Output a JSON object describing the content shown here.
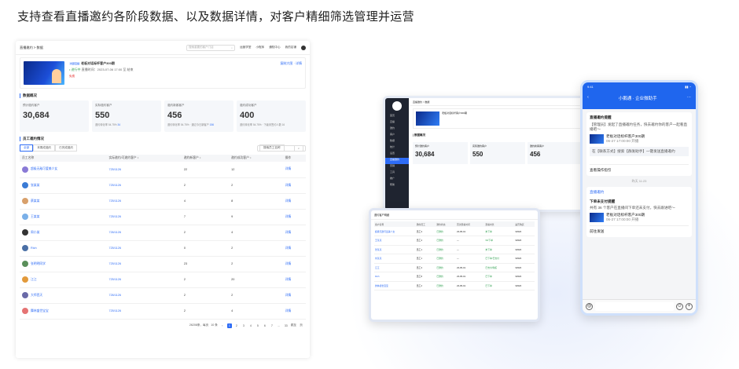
{
  "heading": "支持查看直播邀约各阶段数据、以及数据详情，对客户精细筛选管理并运营",
  "main": {
    "breadcrumb": "直播邀约 > 数据",
    "search_placeholder": "搜索重要的客户门店",
    "toolbar": [
      "运营学堂",
      "小程序",
      "通知中心",
      "我的店铺"
    ],
    "live": {
      "badge": "内部直播",
      "title": "老板对话标杆客户300期",
      "status": "• 进行中",
      "time": "直播时间：2023-07-06 17:00 至 结束",
      "tag": "免费",
      "action": "复制大图 · 详情"
    },
    "overview_title": "数据概况",
    "stats": [
      {
        "label": "预计邀约客户",
        "value": "30,684",
        "sub": ""
      },
      {
        "label": "实际邀约客户",
        "value": "550",
        "sub": "邀约转化率 54.75%",
        "sub2": "34"
      },
      {
        "label": "邀约新客客户",
        "value": "456",
        "sub": "邀约转化率 54.75%  · 通过今日新客户",
        "sub2": "156"
      },
      {
        "label": "邀约成功客户",
        "value": "400",
        "sub": "邀约转化率 54.75%  · 下级未签约人数 16",
        "sub2": ""
      }
    ],
    "detail_title": "员工邀约情况",
    "tabs": [
      "全部",
      "本周成邀约",
      "已完成邀约"
    ],
    "search2": "搜索员工名称",
    "columns": [
      "员工名称",
      "实际邀约/可邀约客户 ↕",
      "邀约新客户 ↕",
      "邀约成功客户 ↕",
      "操作"
    ],
    "rows": [
      {
        "name": "超级无敌可爱美少女",
        "ratio": "725/1126",
        "new": "22",
        "ok": "12",
        "op": "详情",
        "c": "#8a7ad6"
      },
      {
        "name": "张某某",
        "ratio": "725/1126",
        "new": "2",
        "ok": "2",
        "op": "详情",
        "c": "#3a7bd5"
      },
      {
        "name": "蔡某某",
        "ratio": "725/1126",
        "new": "4",
        "ok": "8",
        "op": "详情",
        "c": "#d8a06b"
      },
      {
        "name": "王某某",
        "ratio": "725/1126",
        "new": "7",
        "ok": "9",
        "op": "详情",
        "c": "#7ab0e8"
      },
      {
        "name": "周小某",
        "ratio": "726/1126",
        "new": "2",
        "ok": "4",
        "op": "详情",
        "c": "#333"
      },
      {
        "name": "Rich",
        "ratio": "725/1126",
        "new": "0",
        "ok": "2",
        "op": "详情",
        "c": "#4a6fa5"
      },
      {
        "name": "张明明同学",
        "ratio": "725/1126",
        "new": "23",
        "ok": "2",
        "op": "详情",
        "c": "#5a8f5a"
      },
      {
        "name": "江江",
        "ratio": "725/1126",
        "new": "2",
        "ok": "20",
        "op": "详情",
        "c": "#e29a3b"
      },
      {
        "name": "大师西天",
        "ratio": "726/1126",
        "new": "2",
        "ok": "2",
        "op": "详情",
        "c": "#6a6aa8"
      },
      {
        "name": "舞林盛世宝宝",
        "ratio": "725/1126",
        "new": "2",
        "ok": "4",
        "op": "详情",
        "c": "#e57373"
      }
    ],
    "pager": {
      "total": "26208条，每页",
      "size": "10 条",
      "pages": [
        "1",
        "2",
        "3",
        "4",
        "5",
        "6",
        "7",
        "...",
        "33"
      ],
      "next": "跳至",
      "suffix": "页"
    }
  },
  "tablet": {
    "side": [
      "首页",
      "直播",
      "邀约",
      "客户",
      "数据",
      "统计",
      "设置",
      "直播邀约",
      "营销",
      "工具",
      "推广",
      "帮助"
    ],
    "stats": [
      {
        "l": "预计邀约客户",
        "v": "30,684"
      },
      {
        "l": "实际邀约客户",
        "v": "550"
      },
      {
        "l": "邀约新客客户",
        "v": "456"
      }
    ]
  },
  "ipad": {
    "title": "邀约客户明细",
    "columns": [
      "客户名称",
      "邀约员工",
      "邀约状态",
      "首次观看时间",
      "观看时长",
      "是否购买",
      "成交金额"
    ],
    "rows": [
      [
        "超级无敌可爱美少女",
        "员工3",
        "已邀约",
        "23-05-01",
        "未下单",
        "¥4520"
      ],
      [
        "王某某",
        "员工4",
        "已邀约",
        "—",
        "¥6/下单",
        "¥4520"
      ],
      [
        "张某某",
        "员工1",
        "已邀约",
        "—",
        "未下单",
        "¥4520"
      ],
      [
        "刘某某",
        "员工1",
        "已邀约",
        "—",
        "已下单/已支付",
        "¥4520"
      ],
      [
        "江江",
        "员工3",
        "已邀约",
        "23-05-01",
        "已支付/购买",
        "¥4520"
      ],
      [
        "Rich",
        "员工8",
        "已邀约",
        "23-05-01",
        "已下单",
        "¥4520"
      ],
      [
        "舞林盛世宝宝",
        "员工2",
        "已邀约",
        "23-05-01",
        "已下单",
        "¥4520"
      ]
    ]
  },
  "phone": {
    "time": "9:41",
    "app": "小鹅通 · 企业微助手",
    "notice": "直播邀约提醒",
    "msg1": "【管理员】发起了直播邀约任务，快去邀约你的客户一起看直播吧～",
    "live": "老板对话标杆客户300期",
    "live_time": "06-27 17:00:00 开播",
    "msg2": "在【联系方式】搜索【群发助手】一键发送直播邀约",
    "link1": "查看操作指引",
    "timestamp": "昨天 11:23",
    "sender": "直播邀约",
    "title2": "下单未支付提醒",
    "msg3": "共有 36 个客户在直播间下单还未支付，快去跟进吧～",
    "link2": "前往发送",
    "live2_time": "06-27 17:00:00 开播"
  }
}
